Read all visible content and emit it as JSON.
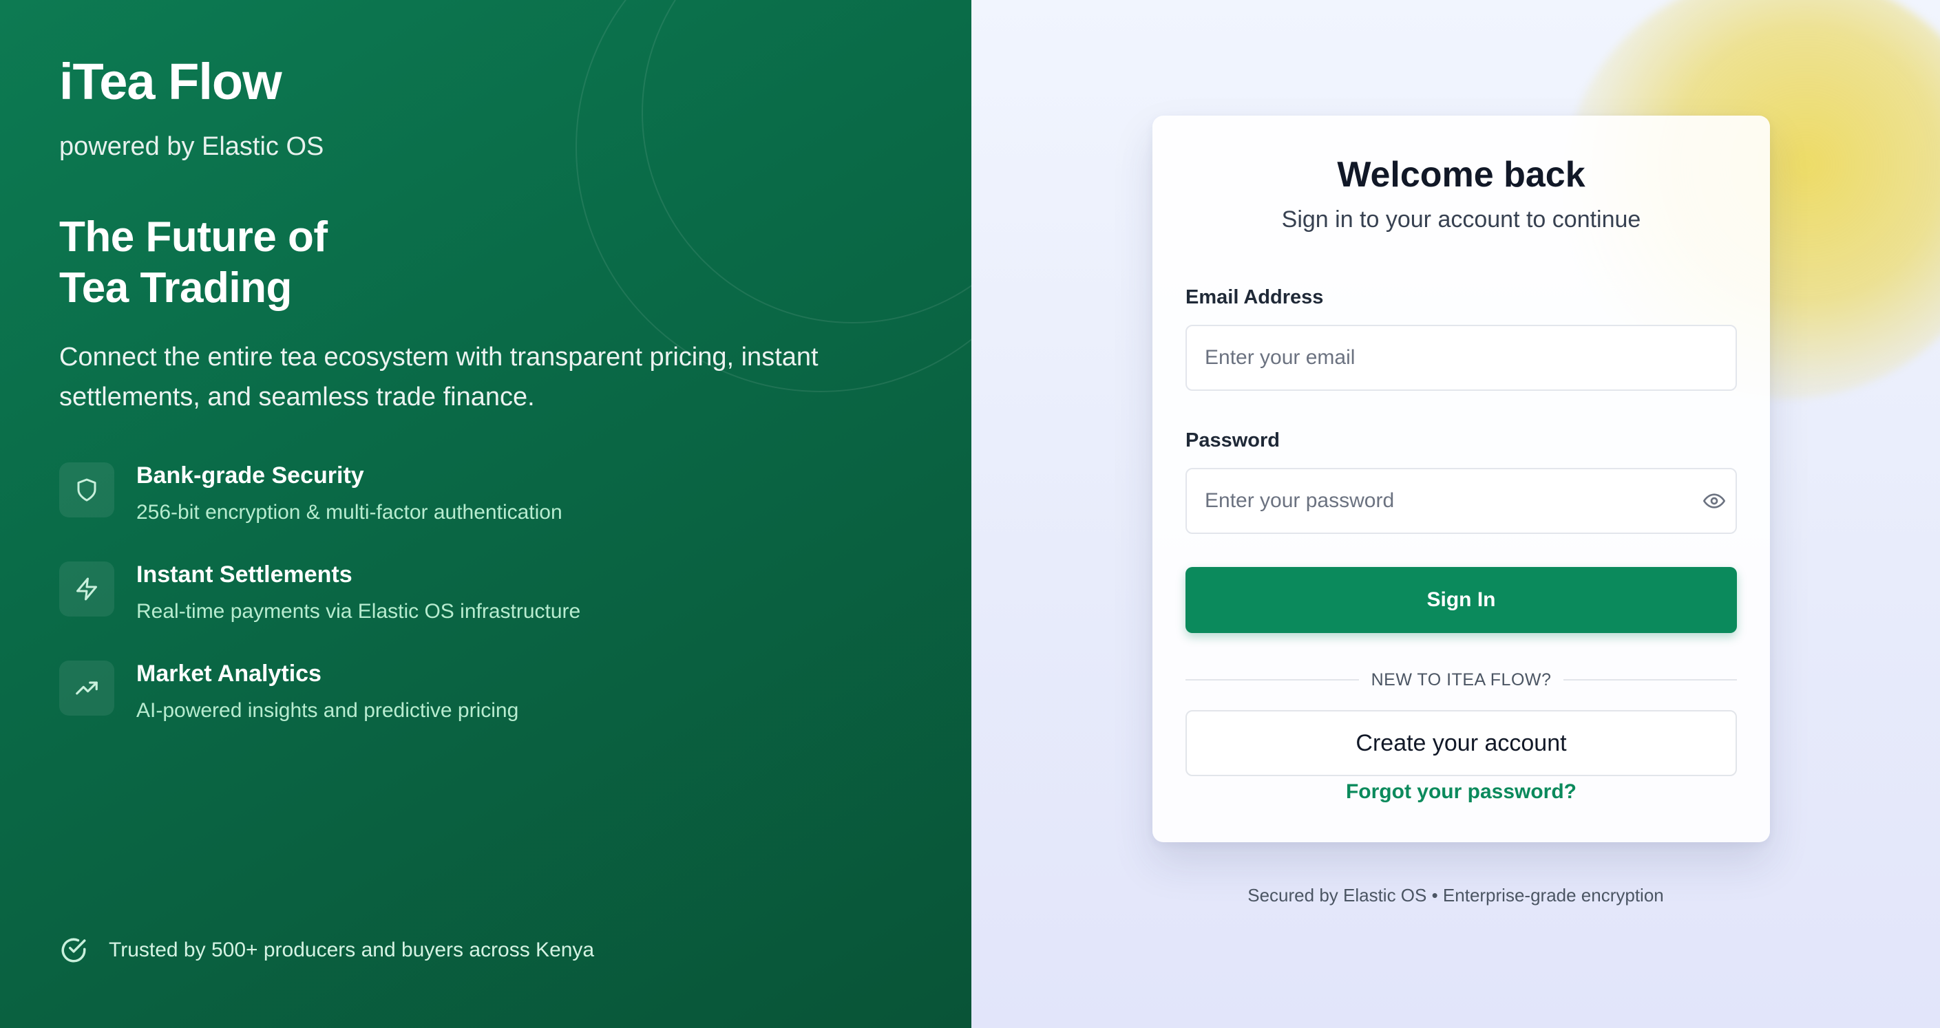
{
  "brand": {
    "title": "iTea Flow",
    "subtitle": "powered by Elastic OS"
  },
  "hero": {
    "line1": "The Future of",
    "line2": "Tea Trading",
    "description": "Connect the entire tea ecosystem with transparent pricing, instant settlements, and seamless trade finance."
  },
  "features": [
    {
      "icon": "shield-icon",
      "title": "Bank-grade Security",
      "description": "256-bit encryption & multi-factor authentication"
    },
    {
      "icon": "lightning-icon",
      "title": "Instant Settlements",
      "description": "Real-time payments via Elastic OS infrastructure"
    },
    {
      "icon": "trending-up-icon",
      "title": "Market Analytics",
      "description": "AI-powered insights and predictive pricing"
    }
  ],
  "trusted": {
    "icon": "check-circle-icon",
    "text": "Trusted by 500+ producers and buyers across Kenya"
  },
  "login": {
    "title": "Welcome back",
    "subtitle": "Sign in to your account to continue",
    "email_label": "Email Address",
    "email_placeholder": "Enter your email",
    "email_value": "",
    "password_label": "Password",
    "password_placeholder": "Enter your password",
    "password_value": "",
    "password_toggle_icon": "eye-icon",
    "signin_label": "Sign In",
    "divider_text": "NEW TO ITEA FLOW?",
    "create_label": "Create your account",
    "forgot_label": "Forgot your password?"
  },
  "footer": {
    "text": "Secured by Elastic OS • Enterprise-grade encryption"
  },
  "colors": {
    "brand_green": "#0b8a5c",
    "panel_green_dark": "#095437",
    "feature_desc": "#b8ecd0",
    "accent_yellow": "#edda5f"
  }
}
